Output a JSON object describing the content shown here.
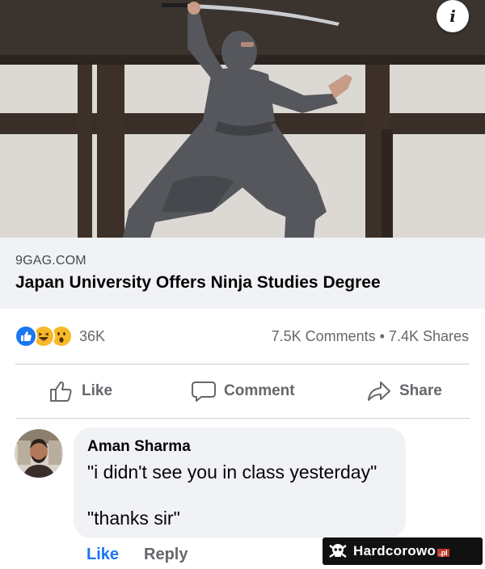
{
  "post": {
    "image_alt": "Person in grey ninja costume holding a katana in front of a wooden-beamed wall",
    "info_icon": "i"
  },
  "link_preview": {
    "domain": "9GAG.COM",
    "title": "Japan University Offers Ninja Studies Degree"
  },
  "stats": {
    "reactions": [
      "like-icon",
      "haha-icon",
      "wow-icon"
    ],
    "reaction_count": "36K",
    "comments_shares": "7.5K Comments • 7.4K Shares"
  },
  "actions": {
    "like": "Like",
    "comment": "Comment",
    "share": "Share"
  },
  "comment": {
    "author": "Aman Sharma",
    "line1": "\"i didn't see you in class yesterday\"",
    "line2": "\"thanks sir\"",
    "like": "Like",
    "reply": "Reply"
  },
  "watermark": {
    "name": "Hardcorowo",
    "tld": ".pl"
  },
  "colors": {
    "accent": "#1877f2",
    "muted": "#65676b",
    "bubble": "#f0f2f5"
  }
}
